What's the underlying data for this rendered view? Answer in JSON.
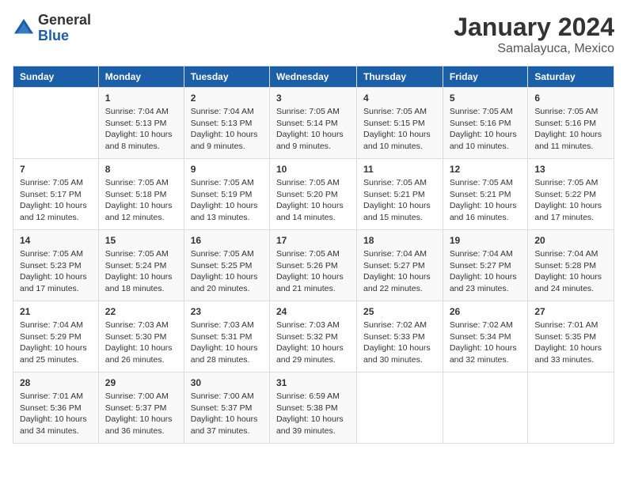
{
  "header": {
    "logo_general": "General",
    "logo_blue": "Blue",
    "month_title": "January 2024",
    "location": "Samalayuca, Mexico"
  },
  "calendar": {
    "days_of_week": [
      "Sunday",
      "Monday",
      "Tuesday",
      "Wednesday",
      "Thursday",
      "Friday",
      "Saturday"
    ],
    "weeks": [
      [
        {
          "day": "",
          "info": ""
        },
        {
          "day": "1",
          "info": "Sunrise: 7:04 AM\nSunset: 5:13 PM\nDaylight: 10 hours\nand 8 minutes."
        },
        {
          "day": "2",
          "info": "Sunrise: 7:04 AM\nSunset: 5:13 PM\nDaylight: 10 hours\nand 9 minutes."
        },
        {
          "day": "3",
          "info": "Sunrise: 7:05 AM\nSunset: 5:14 PM\nDaylight: 10 hours\nand 9 minutes."
        },
        {
          "day": "4",
          "info": "Sunrise: 7:05 AM\nSunset: 5:15 PM\nDaylight: 10 hours\nand 10 minutes."
        },
        {
          "day": "5",
          "info": "Sunrise: 7:05 AM\nSunset: 5:16 PM\nDaylight: 10 hours\nand 10 minutes."
        },
        {
          "day": "6",
          "info": "Sunrise: 7:05 AM\nSunset: 5:16 PM\nDaylight: 10 hours\nand 11 minutes."
        }
      ],
      [
        {
          "day": "7",
          "info": "Sunrise: 7:05 AM\nSunset: 5:17 PM\nDaylight: 10 hours\nand 12 minutes."
        },
        {
          "day": "8",
          "info": "Sunrise: 7:05 AM\nSunset: 5:18 PM\nDaylight: 10 hours\nand 12 minutes."
        },
        {
          "day": "9",
          "info": "Sunrise: 7:05 AM\nSunset: 5:19 PM\nDaylight: 10 hours\nand 13 minutes."
        },
        {
          "day": "10",
          "info": "Sunrise: 7:05 AM\nSunset: 5:20 PM\nDaylight: 10 hours\nand 14 minutes."
        },
        {
          "day": "11",
          "info": "Sunrise: 7:05 AM\nSunset: 5:21 PM\nDaylight: 10 hours\nand 15 minutes."
        },
        {
          "day": "12",
          "info": "Sunrise: 7:05 AM\nSunset: 5:21 PM\nDaylight: 10 hours\nand 16 minutes."
        },
        {
          "day": "13",
          "info": "Sunrise: 7:05 AM\nSunset: 5:22 PM\nDaylight: 10 hours\nand 17 minutes."
        }
      ],
      [
        {
          "day": "14",
          "info": "Sunrise: 7:05 AM\nSunset: 5:23 PM\nDaylight: 10 hours\nand 17 minutes."
        },
        {
          "day": "15",
          "info": "Sunrise: 7:05 AM\nSunset: 5:24 PM\nDaylight: 10 hours\nand 18 minutes."
        },
        {
          "day": "16",
          "info": "Sunrise: 7:05 AM\nSunset: 5:25 PM\nDaylight: 10 hours\nand 20 minutes."
        },
        {
          "day": "17",
          "info": "Sunrise: 7:05 AM\nSunset: 5:26 PM\nDaylight: 10 hours\nand 21 minutes."
        },
        {
          "day": "18",
          "info": "Sunrise: 7:04 AM\nSunset: 5:27 PM\nDaylight: 10 hours\nand 22 minutes."
        },
        {
          "day": "19",
          "info": "Sunrise: 7:04 AM\nSunset: 5:27 PM\nDaylight: 10 hours\nand 23 minutes."
        },
        {
          "day": "20",
          "info": "Sunrise: 7:04 AM\nSunset: 5:28 PM\nDaylight: 10 hours\nand 24 minutes."
        }
      ],
      [
        {
          "day": "21",
          "info": "Sunrise: 7:04 AM\nSunset: 5:29 PM\nDaylight: 10 hours\nand 25 minutes."
        },
        {
          "day": "22",
          "info": "Sunrise: 7:03 AM\nSunset: 5:30 PM\nDaylight: 10 hours\nand 26 minutes."
        },
        {
          "day": "23",
          "info": "Sunrise: 7:03 AM\nSunset: 5:31 PM\nDaylight: 10 hours\nand 28 minutes."
        },
        {
          "day": "24",
          "info": "Sunrise: 7:03 AM\nSunset: 5:32 PM\nDaylight: 10 hours\nand 29 minutes."
        },
        {
          "day": "25",
          "info": "Sunrise: 7:02 AM\nSunset: 5:33 PM\nDaylight: 10 hours\nand 30 minutes."
        },
        {
          "day": "26",
          "info": "Sunrise: 7:02 AM\nSunset: 5:34 PM\nDaylight: 10 hours\nand 32 minutes."
        },
        {
          "day": "27",
          "info": "Sunrise: 7:01 AM\nSunset: 5:35 PM\nDaylight: 10 hours\nand 33 minutes."
        }
      ],
      [
        {
          "day": "28",
          "info": "Sunrise: 7:01 AM\nSunset: 5:36 PM\nDaylight: 10 hours\nand 34 minutes."
        },
        {
          "day": "29",
          "info": "Sunrise: 7:00 AM\nSunset: 5:37 PM\nDaylight: 10 hours\nand 36 minutes."
        },
        {
          "day": "30",
          "info": "Sunrise: 7:00 AM\nSunset: 5:37 PM\nDaylight: 10 hours\nand 37 minutes."
        },
        {
          "day": "31",
          "info": "Sunrise: 6:59 AM\nSunset: 5:38 PM\nDaylight: 10 hours\nand 39 minutes."
        },
        {
          "day": "",
          "info": ""
        },
        {
          "day": "",
          "info": ""
        },
        {
          "day": "",
          "info": ""
        }
      ]
    ]
  }
}
